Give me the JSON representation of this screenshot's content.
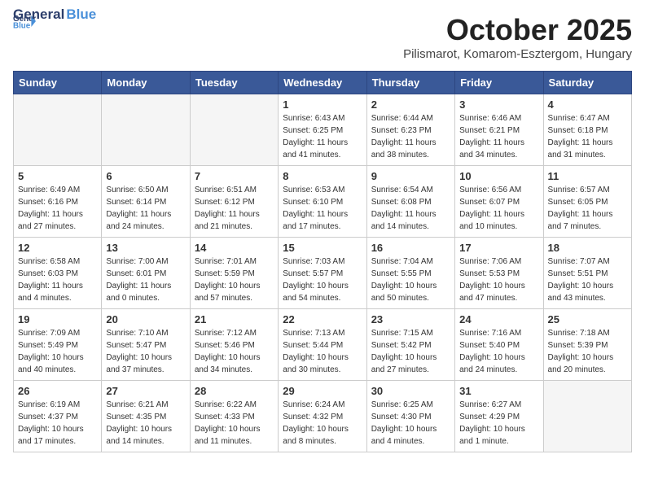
{
  "logo": {
    "general": "General",
    "blue": "Blue"
  },
  "header": {
    "month": "October 2025",
    "location": "Pilismarot, Komarom-Esztergom, Hungary"
  },
  "weekdays": [
    "Sunday",
    "Monday",
    "Tuesday",
    "Wednesday",
    "Thursday",
    "Friday",
    "Saturday"
  ],
  "weeks": [
    [
      {
        "day": "",
        "info": ""
      },
      {
        "day": "",
        "info": ""
      },
      {
        "day": "",
        "info": ""
      },
      {
        "day": "1",
        "info": "Sunrise: 6:43 AM\nSunset: 6:25 PM\nDaylight: 11 hours\nand 41 minutes."
      },
      {
        "day": "2",
        "info": "Sunrise: 6:44 AM\nSunset: 6:23 PM\nDaylight: 11 hours\nand 38 minutes."
      },
      {
        "day": "3",
        "info": "Sunrise: 6:46 AM\nSunset: 6:21 PM\nDaylight: 11 hours\nand 34 minutes."
      },
      {
        "day": "4",
        "info": "Sunrise: 6:47 AM\nSunset: 6:18 PM\nDaylight: 11 hours\nand 31 minutes."
      }
    ],
    [
      {
        "day": "5",
        "info": "Sunrise: 6:49 AM\nSunset: 6:16 PM\nDaylight: 11 hours\nand 27 minutes."
      },
      {
        "day": "6",
        "info": "Sunrise: 6:50 AM\nSunset: 6:14 PM\nDaylight: 11 hours\nand 24 minutes."
      },
      {
        "day": "7",
        "info": "Sunrise: 6:51 AM\nSunset: 6:12 PM\nDaylight: 11 hours\nand 21 minutes."
      },
      {
        "day": "8",
        "info": "Sunrise: 6:53 AM\nSunset: 6:10 PM\nDaylight: 11 hours\nand 17 minutes."
      },
      {
        "day": "9",
        "info": "Sunrise: 6:54 AM\nSunset: 6:08 PM\nDaylight: 11 hours\nand 14 minutes."
      },
      {
        "day": "10",
        "info": "Sunrise: 6:56 AM\nSunset: 6:07 PM\nDaylight: 11 hours\nand 10 minutes."
      },
      {
        "day": "11",
        "info": "Sunrise: 6:57 AM\nSunset: 6:05 PM\nDaylight: 11 hours\nand 7 minutes."
      }
    ],
    [
      {
        "day": "12",
        "info": "Sunrise: 6:58 AM\nSunset: 6:03 PM\nDaylight: 11 hours\nand 4 minutes."
      },
      {
        "day": "13",
        "info": "Sunrise: 7:00 AM\nSunset: 6:01 PM\nDaylight: 11 hours\nand 0 minutes."
      },
      {
        "day": "14",
        "info": "Sunrise: 7:01 AM\nSunset: 5:59 PM\nDaylight: 10 hours\nand 57 minutes."
      },
      {
        "day": "15",
        "info": "Sunrise: 7:03 AM\nSunset: 5:57 PM\nDaylight: 10 hours\nand 54 minutes."
      },
      {
        "day": "16",
        "info": "Sunrise: 7:04 AM\nSunset: 5:55 PM\nDaylight: 10 hours\nand 50 minutes."
      },
      {
        "day": "17",
        "info": "Sunrise: 7:06 AM\nSunset: 5:53 PM\nDaylight: 10 hours\nand 47 minutes."
      },
      {
        "day": "18",
        "info": "Sunrise: 7:07 AM\nSunset: 5:51 PM\nDaylight: 10 hours\nand 43 minutes."
      }
    ],
    [
      {
        "day": "19",
        "info": "Sunrise: 7:09 AM\nSunset: 5:49 PM\nDaylight: 10 hours\nand 40 minutes."
      },
      {
        "day": "20",
        "info": "Sunrise: 7:10 AM\nSunset: 5:47 PM\nDaylight: 10 hours\nand 37 minutes."
      },
      {
        "day": "21",
        "info": "Sunrise: 7:12 AM\nSunset: 5:46 PM\nDaylight: 10 hours\nand 34 minutes."
      },
      {
        "day": "22",
        "info": "Sunrise: 7:13 AM\nSunset: 5:44 PM\nDaylight: 10 hours\nand 30 minutes."
      },
      {
        "day": "23",
        "info": "Sunrise: 7:15 AM\nSunset: 5:42 PM\nDaylight: 10 hours\nand 27 minutes."
      },
      {
        "day": "24",
        "info": "Sunrise: 7:16 AM\nSunset: 5:40 PM\nDaylight: 10 hours\nand 24 minutes."
      },
      {
        "day": "25",
        "info": "Sunrise: 7:18 AM\nSunset: 5:39 PM\nDaylight: 10 hours\nand 20 minutes."
      }
    ],
    [
      {
        "day": "26",
        "info": "Sunrise: 6:19 AM\nSunset: 4:37 PM\nDaylight: 10 hours\nand 17 minutes."
      },
      {
        "day": "27",
        "info": "Sunrise: 6:21 AM\nSunset: 4:35 PM\nDaylight: 10 hours\nand 14 minutes."
      },
      {
        "day": "28",
        "info": "Sunrise: 6:22 AM\nSunset: 4:33 PM\nDaylight: 10 hours\nand 11 minutes."
      },
      {
        "day": "29",
        "info": "Sunrise: 6:24 AM\nSunset: 4:32 PM\nDaylight: 10 hours\nand 8 minutes."
      },
      {
        "day": "30",
        "info": "Sunrise: 6:25 AM\nSunset: 4:30 PM\nDaylight: 10 hours\nand 4 minutes."
      },
      {
        "day": "31",
        "info": "Sunrise: 6:27 AM\nSunset: 4:29 PM\nDaylight: 10 hours\nand 1 minute."
      },
      {
        "day": "",
        "info": ""
      }
    ]
  ]
}
